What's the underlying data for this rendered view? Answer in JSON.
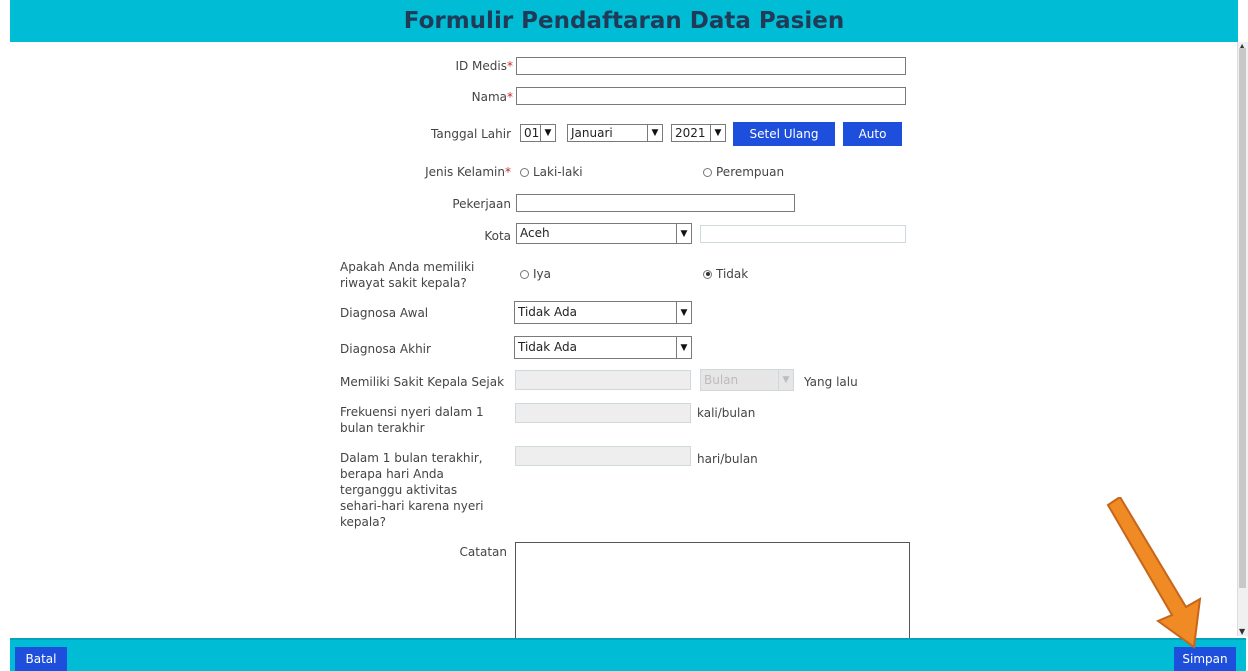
{
  "header": {
    "title": "Formulir Pendaftaran Data Pasien"
  },
  "form": {
    "id_medis": {
      "label": "ID Medis",
      "required": "*",
      "value": ""
    },
    "nama": {
      "label": "Nama",
      "required": "*",
      "value": ""
    },
    "tanggal_lahir": {
      "label": "Tanggal Lahir",
      "day": "01",
      "month": "Januari",
      "year": "2021",
      "reset_label": "Setel Ulang",
      "auto_label": "Auto"
    },
    "jenis_kelamin": {
      "label": "Jenis Kelamin",
      "required": "*",
      "options": [
        "Laki-laki",
        "Perempuan"
      ]
    },
    "pekerjaan": {
      "label": "Pekerjaan",
      "value": ""
    },
    "kota": {
      "label": "Kota",
      "value": "Aceh",
      "extra": ""
    },
    "riwayat": {
      "label_line1": "Apakah Anda memiliki",
      "label_line2": "riwayat sakit kepala?",
      "options": [
        "Iya",
        "Tidak"
      ],
      "selected": "Tidak"
    },
    "diagnosa_awal": {
      "label": "Diagnosa Awal",
      "value": "Tidak Ada"
    },
    "diagnosa_akhir": {
      "label": "Diagnosa Akhir",
      "value": "Tidak Ada"
    },
    "sejak": {
      "label": "Memiliki Sakit Kepala Sejak",
      "unit": "Bulan",
      "suffix": "Yang lalu"
    },
    "frekuensi": {
      "label_line1": "Frekuensi nyeri dalam 1",
      "label_line2": "bulan terakhir",
      "unit": "kali/bulan"
    },
    "terganggu": {
      "label_lines": [
        "Dalam 1 bulan terakhir,",
        "berapa hari Anda",
        "terganggu aktivitas",
        "sehari-hari karena nyeri",
        "kepala?"
      ],
      "unit": "hari/bulan"
    },
    "catatan": {
      "label": "Catatan"
    }
  },
  "footer": {
    "cancel_label": "Batal",
    "save_label": "Simpan"
  },
  "colors": {
    "header_bg": "#00bcd4",
    "button_bg": "#1e4fdc",
    "annotation_arrow": "#f08a24"
  }
}
